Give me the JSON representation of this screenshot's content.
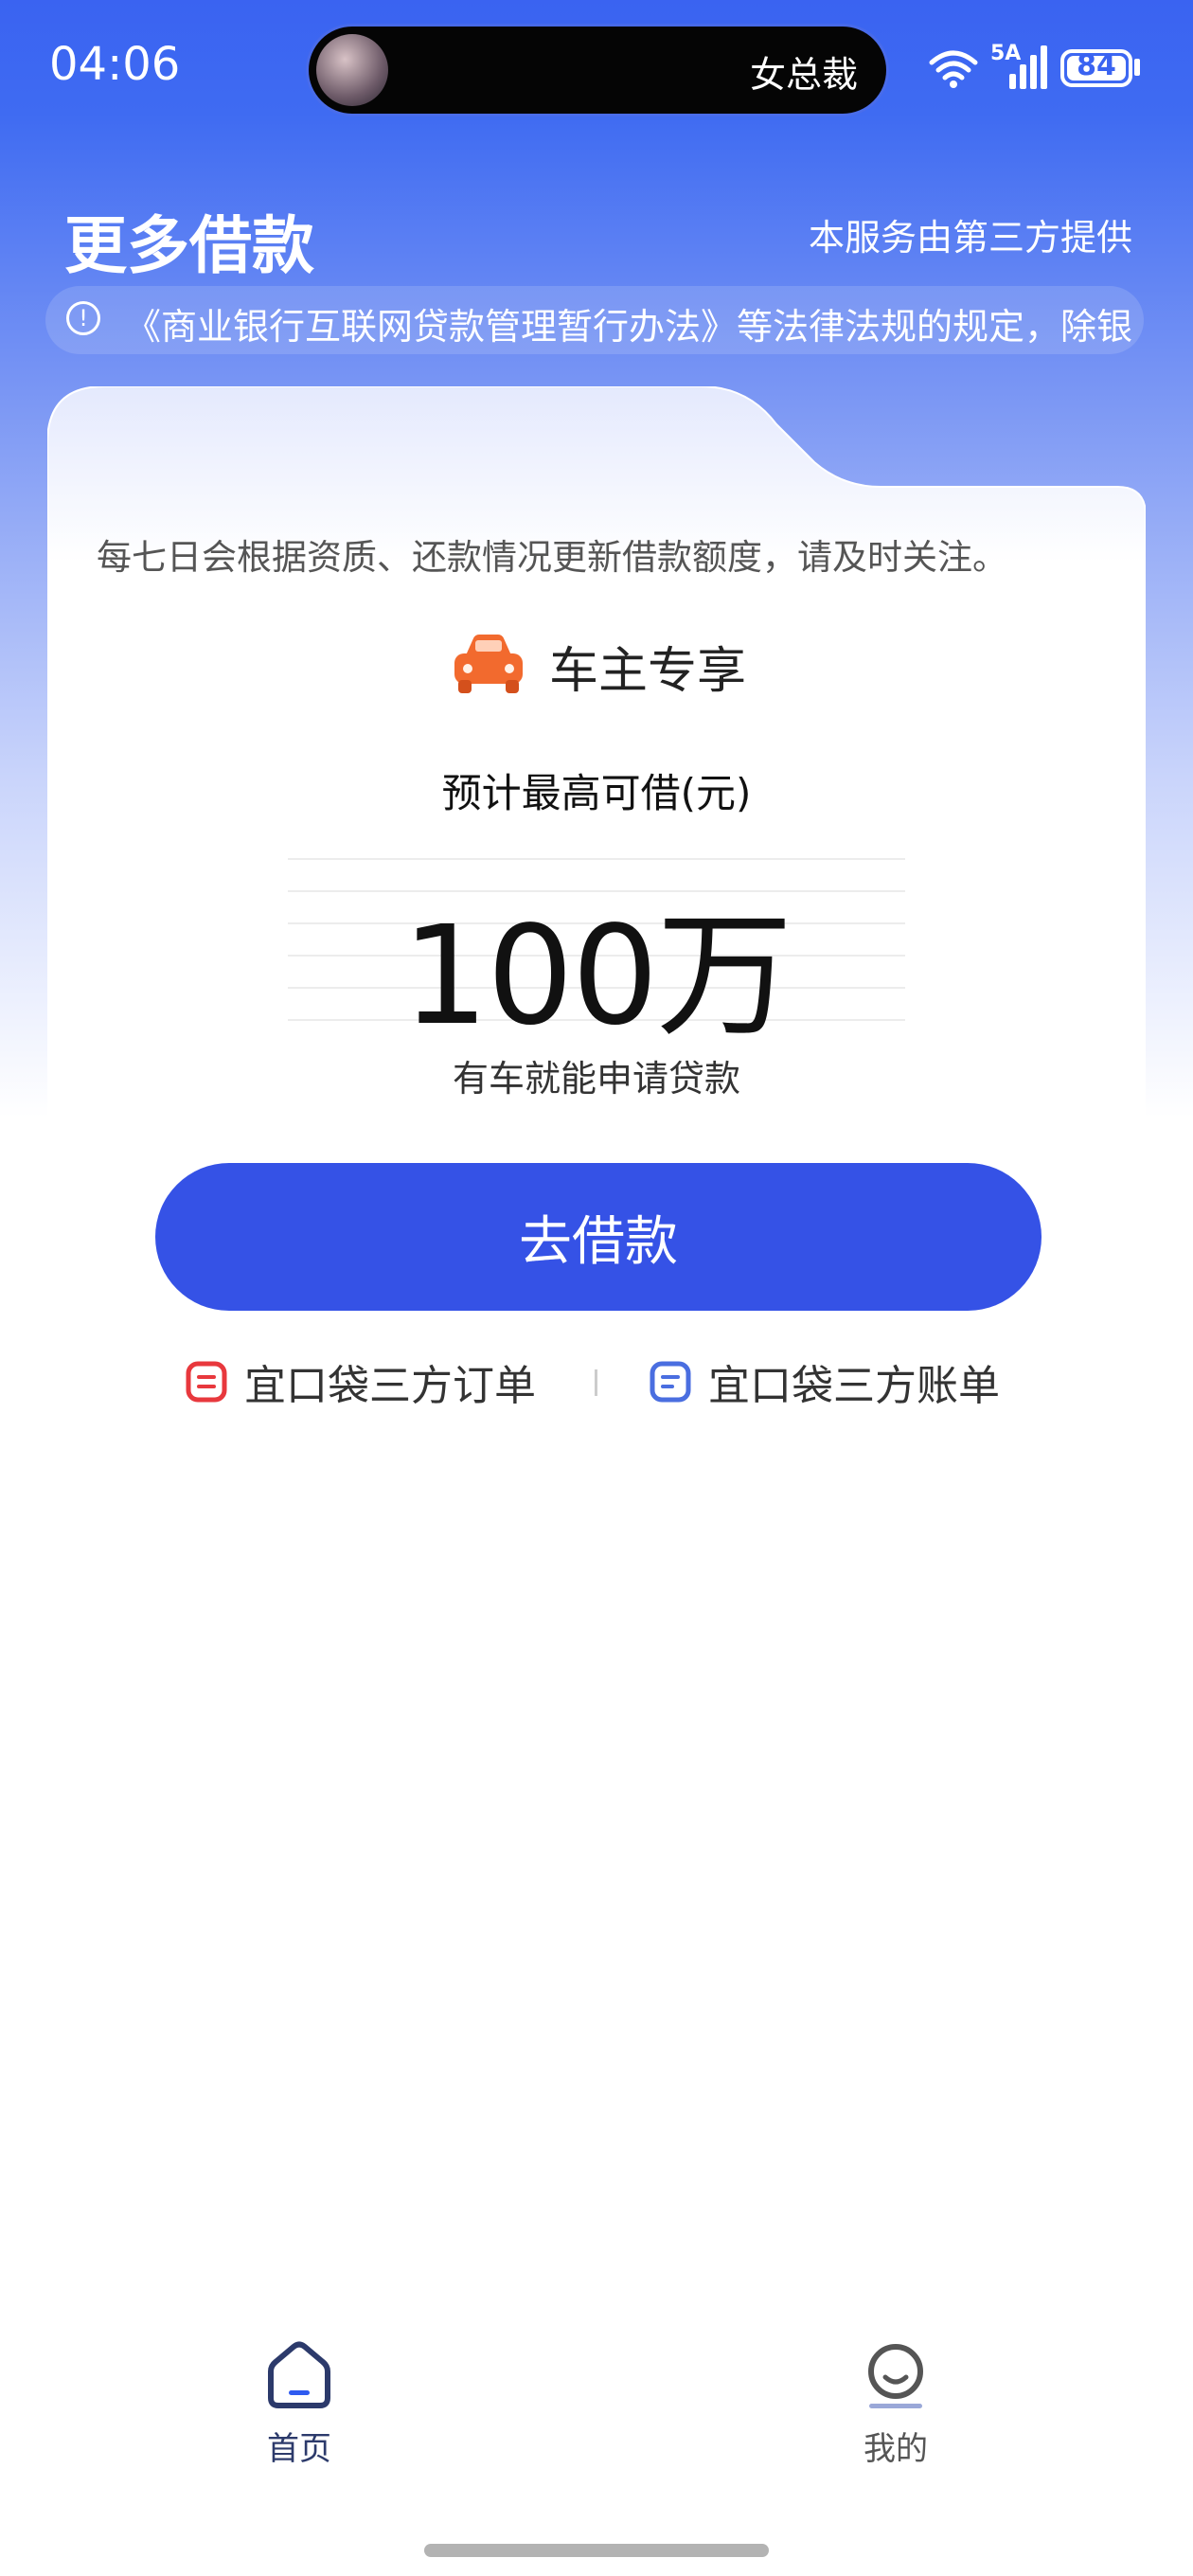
{
  "status_bar": {
    "time": "04:06",
    "island_text": "女总裁",
    "signal_label": "5A",
    "battery": "84"
  },
  "header": {
    "title": "更多借款",
    "provider_note": "本服务由第三方提供"
  },
  "notice": {
    "text": "《商业银行互联网贷款管理暂行办法》等法律法规的规定，除银"
  },
  "card": {
    "description": "每七日会根据资质、还款情况更新借款额度，请及时关注。",
    "badge": "车主专享",
    "limit_caption": "预计最高可借(元)",
    "amount": "100万",
    "amount_sub": "有车就能申请贷款",
    "borrow_button": "去借款",
    "orders_link": "宜口袋三方订单",
    "bills_link": "宜口袋三方账单"
  },
  "bottom_nav": {
    "items": [
      {
        "label": "首页",
        "icon": "home-icon",
        "active": true
      },
      {
        "label": "我的",
        "icon": "profile-icon",
        "active": false
      }
    ]
  },
  "colors": {
    "brand_blue": "#3552e6",
    "header_blue": "#3a63f1",
    "orders_icon": "#e8383d",
    "bills_icon": "#4a6ee0",
    "car_icon": "#f26a2e"
  }
}
